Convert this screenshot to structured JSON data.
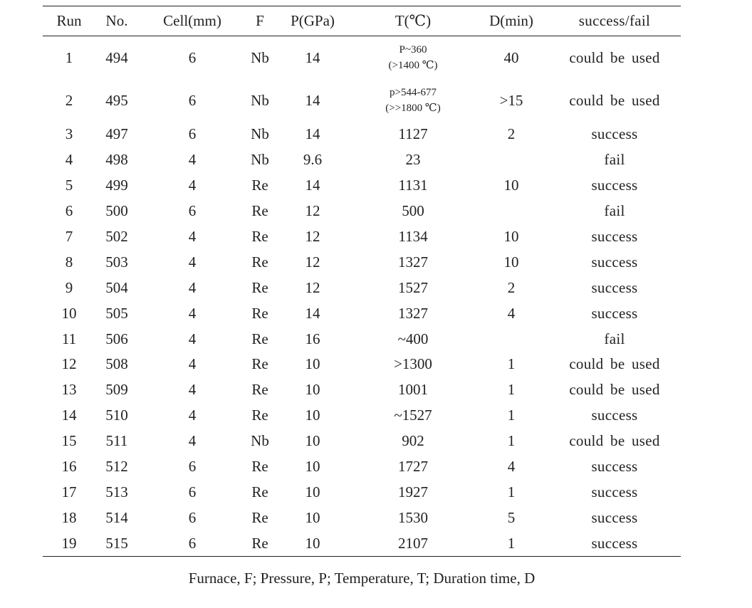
{
  "table": {
    "headers": [
      "Run",
      "No.",
      "Cell(mm)",
      "F",
      "P(GPa)",
      "T(℃)",
      "D(min)",
      "success/fail"
    ],
    "rows": [
      {
        "run": "1",
        "no": "494",
        "cell": "6",
        "f": "Nb",
        "p": "14",
        "t": [
          "P~360",
          "(>1400 ℃)"
        ],
        "d": "40",
        "result": "could be used"
      },
      {
        "run": "2",
        "no": "495",
        "cell": "6",
        "f": "Nb",
        "p": "14",
        "t": [
          "p>544-677",
          "(>>1800 ℃)"
        ],
        "d": ">15",
        "result": "could be used"
      },
      {
        "run": "3",
        "no": "497",
        "cell": "6",
        "f": "Nb",
        "p": "14",
        "t": "1127",
        "d": "2",
        "result": "success"
      },
      {
        "run": "4",
        "no": "498",
        "cell": "4",
        "f": "Nb",
        "p": "9.6",
        "t": "23",
        "d": "",
        "result": "fail"
      },
      {
        "run": "5",
        "no": "499",
        "cell": "4",
        "f": "Re",
        "p": "14",
        "t": "1131",
        "d": "10",
        "result": "success"
      },
      {
        "run": "6",
        "no": "500",
        "cell": "6",
        "f": "Re",
        "p": "12",
        "t": "500",
        "d": "",
        "result": "fail"
      },
      {
        "run": "7",
        "no": "502",
        "cell": "4",
        "f": "Re",
        "p": "12",
        "t": "1134",
        "d": "10",
        "result": "success"
      },
      {
        "run": "8",
        "no": "503",
        "cell": "4",
        "f": "Re",
        "p": "12",
        "t": "1327",
        "d": "10",
        "result": "success"
      },
      {
        "run": "9",
        "no": "504",
        "cell": "4",
        "f": "Re",
        "p": "12",
        "t": "1527",
        "d": "2",
        "result": "success"
      },
      {
        "run": "10",
        "no": "505",
        "cell": "4",
        "f": "Re",
        "p": "14",
        "t": "1327",
        "d": "4",
        "result": "success"
      },
      {
        "run": "11",
        "no": "506",
        "cell": "4",
        "f": "Re",
        "p": "16",
        "t": "~400",
        "d": "",
        "result": "fail"
      },
      {
        "run": "12",
        "no": "508",
        "cell": "4",
        "f": "Re",
        "p": "10",
        "t": ">1300",
        "d": "1",
        "result": "could be used"
      },
      {
        "run": "13",
        "no": "509",
        "cell": "4",
        "f": "Re",
        "p": "10",
        "t": "1001",
        "d": "1",
        "result": "could be used"
      },
      {
        "run": "14",
        "no": "510",
        "cell": "4",
        "f": "Re",
        "p": "10",
        "t": "~1527",
        "d": "1",
        "result": "success"
      },
      {
        "run": "15",
        "no": "511",
        "cell": "4",
        "f": "Nb",
        "p": "10",
        "t": "902",
        "d": "1",
        "result": "could be used"
      },
      {
        "run": "16",
        "no": "512",
        "cell": "6",
        "f": "Re",
        "p": "10",
        "t": "1727",
        "d": "4",
        "result": "success"
      },
      {
        "run": "17",
        "no": "513",
        "cell": "6",
        "f": "Re",
        "p": "10",
        "t": "1927",
        "d": "1",
        "result": "success"
      },
      {
        "run": "18",
        "no": "514",
        "cell": "6",
        "f": "Re",
        "p": "10",
        "t": "1530",
        "d": "5",
        "result": "success"
      },
      {
        "run": "19",
        "no": "515",
        "cell": "6",
        "f": "Re",
        "p": "10",
        "t": "2107",
        "d": "1",
        "result": "success"
      }
    ]
  },
  "caption": "Furnace, F; Pressure, P; Temperature, T; Duration time, D"
}
